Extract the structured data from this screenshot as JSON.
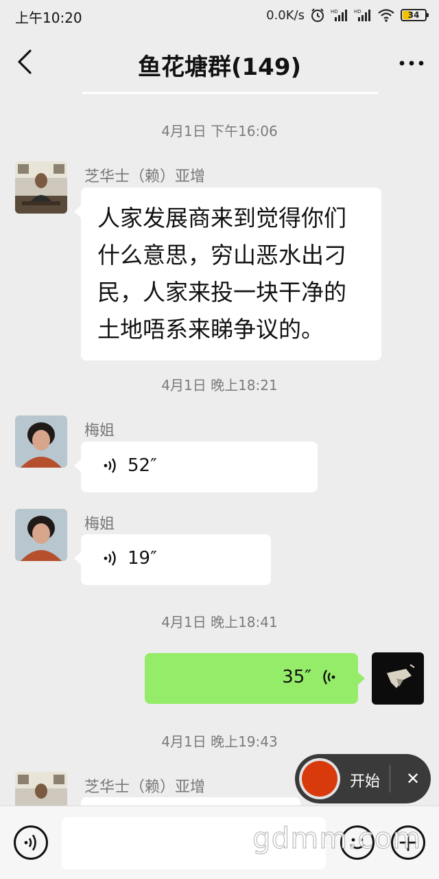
{
  "status_bar": {
    "time": "上午10:20",
    "network_speed": "0.0K/s",
    "battery": "34",
    "battery_level": 0.34,
    "icons": [
      "alarm-icon",
      "hd-signal-icon",
      "hd-signal-icon",
      "wifi-icon",
      "battery-icon"
    ]
  },
  "header": {
    "title": "鱼花塘群(149)",
    "back_icon": "chevron-left-icon",
    "more_icon": "more-dots-icon"
  },
  "messages": [
    {
      "type": "timestamp",
      "text": "4月1日 下午16:06"
    },
    {
      "type": "text",
      "side": "left",
      "sender": "芝华士（赖）亚增",
      "text": "人家发展商来到觉得你们什么意思，穷山恶水出刁民，人家来投一块干净的土地唔系来睇争议的。"
    },
    {
      "type": "timestamp",
      "text": "4月1日 晚上18:21"
    },
    {
      "type": "voice",
      "side": "left",
      "sender": "梅姐",
      "duration": "52″"
    },
    {
      "type": "voice",
      "side": "left",
      "sender": "梅姐",
      "duration": "19″"
    },
    {
      "type": "timestamp",
      "text": "4月1日 晚上18:41"
    },
    {
      "type": "voice",
      "side": "right",
      "duration": "35″"
    },
    {
      "type": "timestamp",
      "text": "4月1日 晚上19:43"
    },
    {
      "type": "text",
      "side": "left",
      "sender": "芝华士（赖）亚增",
      "text": ""
    }
  ],
  "recorder": {
    "start_label": "开始",
    "close_label": "✕",
    "accent_color": "#d93a0b"
  },
  "input_bar": {
    "voice_icon": "voice-input-icon",
    "emoji_icon": "emoji-icon",
    "plus_icon": "plus-icon",
    "text_value": ""
  },
  "watermark": "gdmm.com",
  "colors": {
    "background": "#ededed",
    "bubble_left": "#ffffff",
    "bubble_right": "#95ec69"
  }
}
